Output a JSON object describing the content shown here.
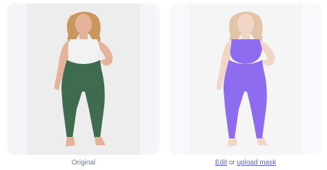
{
  "original_panel": {
    "caption": "Original",
    "top_color": "#f2f2f2",
    "leggings_color": "#3f6b4f",
    "skin_color": "#e5b39a",
    "hair_color": "#c9965d"
  },
  "mask_panel": {
    "edit_link": "Edit",
    "separator": "or",
    "upload_link": "upload mask",
    "mask_color": "#8e6cf0",
    "overlay_color": "#ffffff"
  },
  "icons": [
    "person-photo",
    "masked-person-photo"
  ]
}
